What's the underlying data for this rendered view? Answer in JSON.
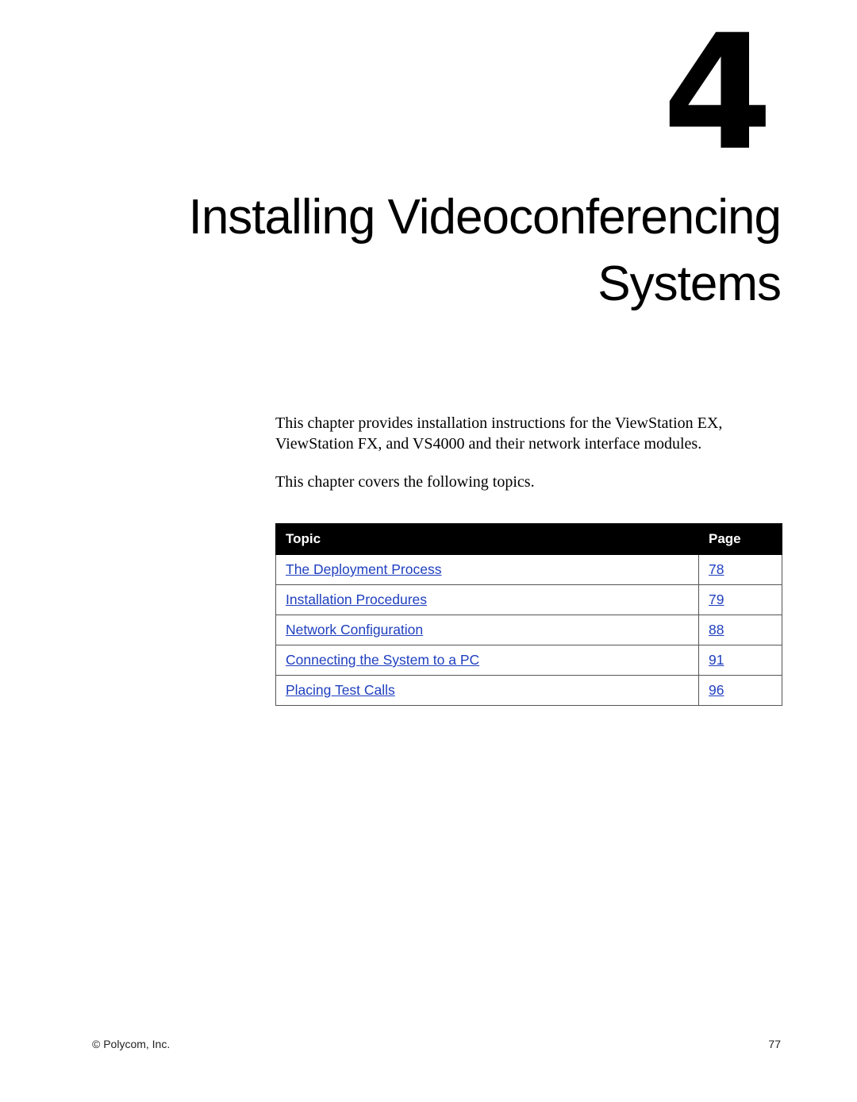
{
  "chapter": {
    "number": "4",
    "title_line1": "Installing Videoconferencing",
    "title_line2": "Systems"
  },
  "intro": {
    "paragraph1": "This chapter provides installation instructions for the ViewStation EX, ViewStation FX, and VS4000 and their network interface modules.",
    "paragraph2": "This chapter covers the following topics."
  },
  "topics_table": {
    "headers": {
      "topic": "Topic",
      "page": "Page"
    },
    "rows": [
      {
        "topic": "The Deployment Process",
        "page": "78"
      },
      {
        "topic": "Installation Procedures",
        "page": "79"
      },
      {
        "topic": "Network Configuration",
        "page": "88"
      },
      {
        "topic": "Connecting the System to a PC",
        "page": "91"
      },
      {
        "topic": "Placing Test Calls",
        "page": "96"
      }
    ]
  },
  "footer": {
    "copyright": "© Polycom, Inc.",
    "page_number": "77"
  },
  "colors": {
    "link": "#1f3fbf",
    "header_bg": "#000000"
  }
}
